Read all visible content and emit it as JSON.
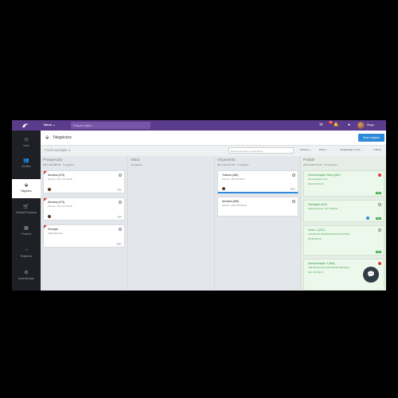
{
  "topbar": {
    "menu_label": "Novo",
    "search_placeholder": "Pesquise rápido...",
    "notifications_count": "99",
    "user_name": "Diogo"
  },
  "sidebar": {
    "items": [
      {
        "label": "Início",
        "icon": "clock-icon"
      },
      {
        "label": "Clientes",
        "icon": "users-icon"
      },
      {
        "label": "Negócios",
        "icon": "tag-icon"
      },
      {
        "label": "Vendas/Pesquisas",
        "icon": "cart-icon"
      },
      {
        "label": "Produtos",
        "icon": "box-icon"
      },
      {
        "label": "Relatórios",
        "icon": "chart-icon"
      },
      {
        "label": "Administração",
        "icon": "gear-icon"
      }
    ]
  },
  "header": {
    "title": "Negócios",
    "new_button": "Novo negócio"
  },
  "subheader": {
    "funnel_name": "Funil exemplo 1",
    "search_placeholder": "Buscar pelo título ou pelo cliente",
    "order_label": "Ordenar",
    "filters_label": "Filtros",
    "view_label": "Visualização: Funil",
    "menu_label": "Menu"
  },
  "columns": [
    {
      "title": "Prospecção",
      "sub": "R$ 1.381.888,00 · 3 negócios"
    },
    {
      "title": "Visita",
      "sub": "0 negócios"
    },
    {
      "title": "Orçamento",
      "sub": "R$ 1.334.787,87 · 2 negócios"
    },
    {
      "title": "Pedido",
      "sub": "R$ 34.096.270,24 · 14 negócios"
    }
  ],
  "cards": {
    "prospeccao": [
      {
        "title": "Alumina (#75)",
        "sub": "Alumina · R$ 1.274.518,00",
        "tag": "HH"
      },
      {
        "title": "Alumina (#73)",
        "sub": "Alumina · R$ 1.167.000,00",
        "tag": "HH"
      },
      {
        "title": "Exemplo",
        "sub": "Digital Machines",
        "tag": "Hoje"
      }
    ],
    "orcamento": [
      {
        "title": "Testeok (#84)",
        "sub": "Alumina · R$ 340.096,87",
        "tag": "Hoje"
      },
      {
        "title": "Alumina (#69)",
        "sub": "Alumina · R$ 3.780.652,00"
      }
    ],
    "pedido": [
      {
        "title": "Demonstração Henry (#57)",
        "sub": "Demonstração Henry",
        "value": "R$ 2.367.000,00",
        "tag": "RUB"
      },
      {
        "title": "Patinação (#22)",
        "sub": "Digital Machines · R$ 70.000,00",
        "tag": "Hoje"
      },
      {
        "title": "Demo 1 (#22)",
        "sub": "GRANPLINE MATERIAIS PARA ESCRITÓRI...",
        "value": "R$ 380.000,00",
        "tag": "RUB"
      },
      {
        "title": "Demonstração 2 (#62)",
        "sub": "TEB TECNOLOGIA ELETRONICA BRASILEI...",
        "value": "R$ 1.437.950,75"
      }
    ]
  },
  "colors": {
    "topbar": "#5a3b8c",
    "sidebar": "#1f2026",
    "accent": "#2e8ad8",
    "success": "#3faa4c",
    "danger": "#e53935"
  }
}
